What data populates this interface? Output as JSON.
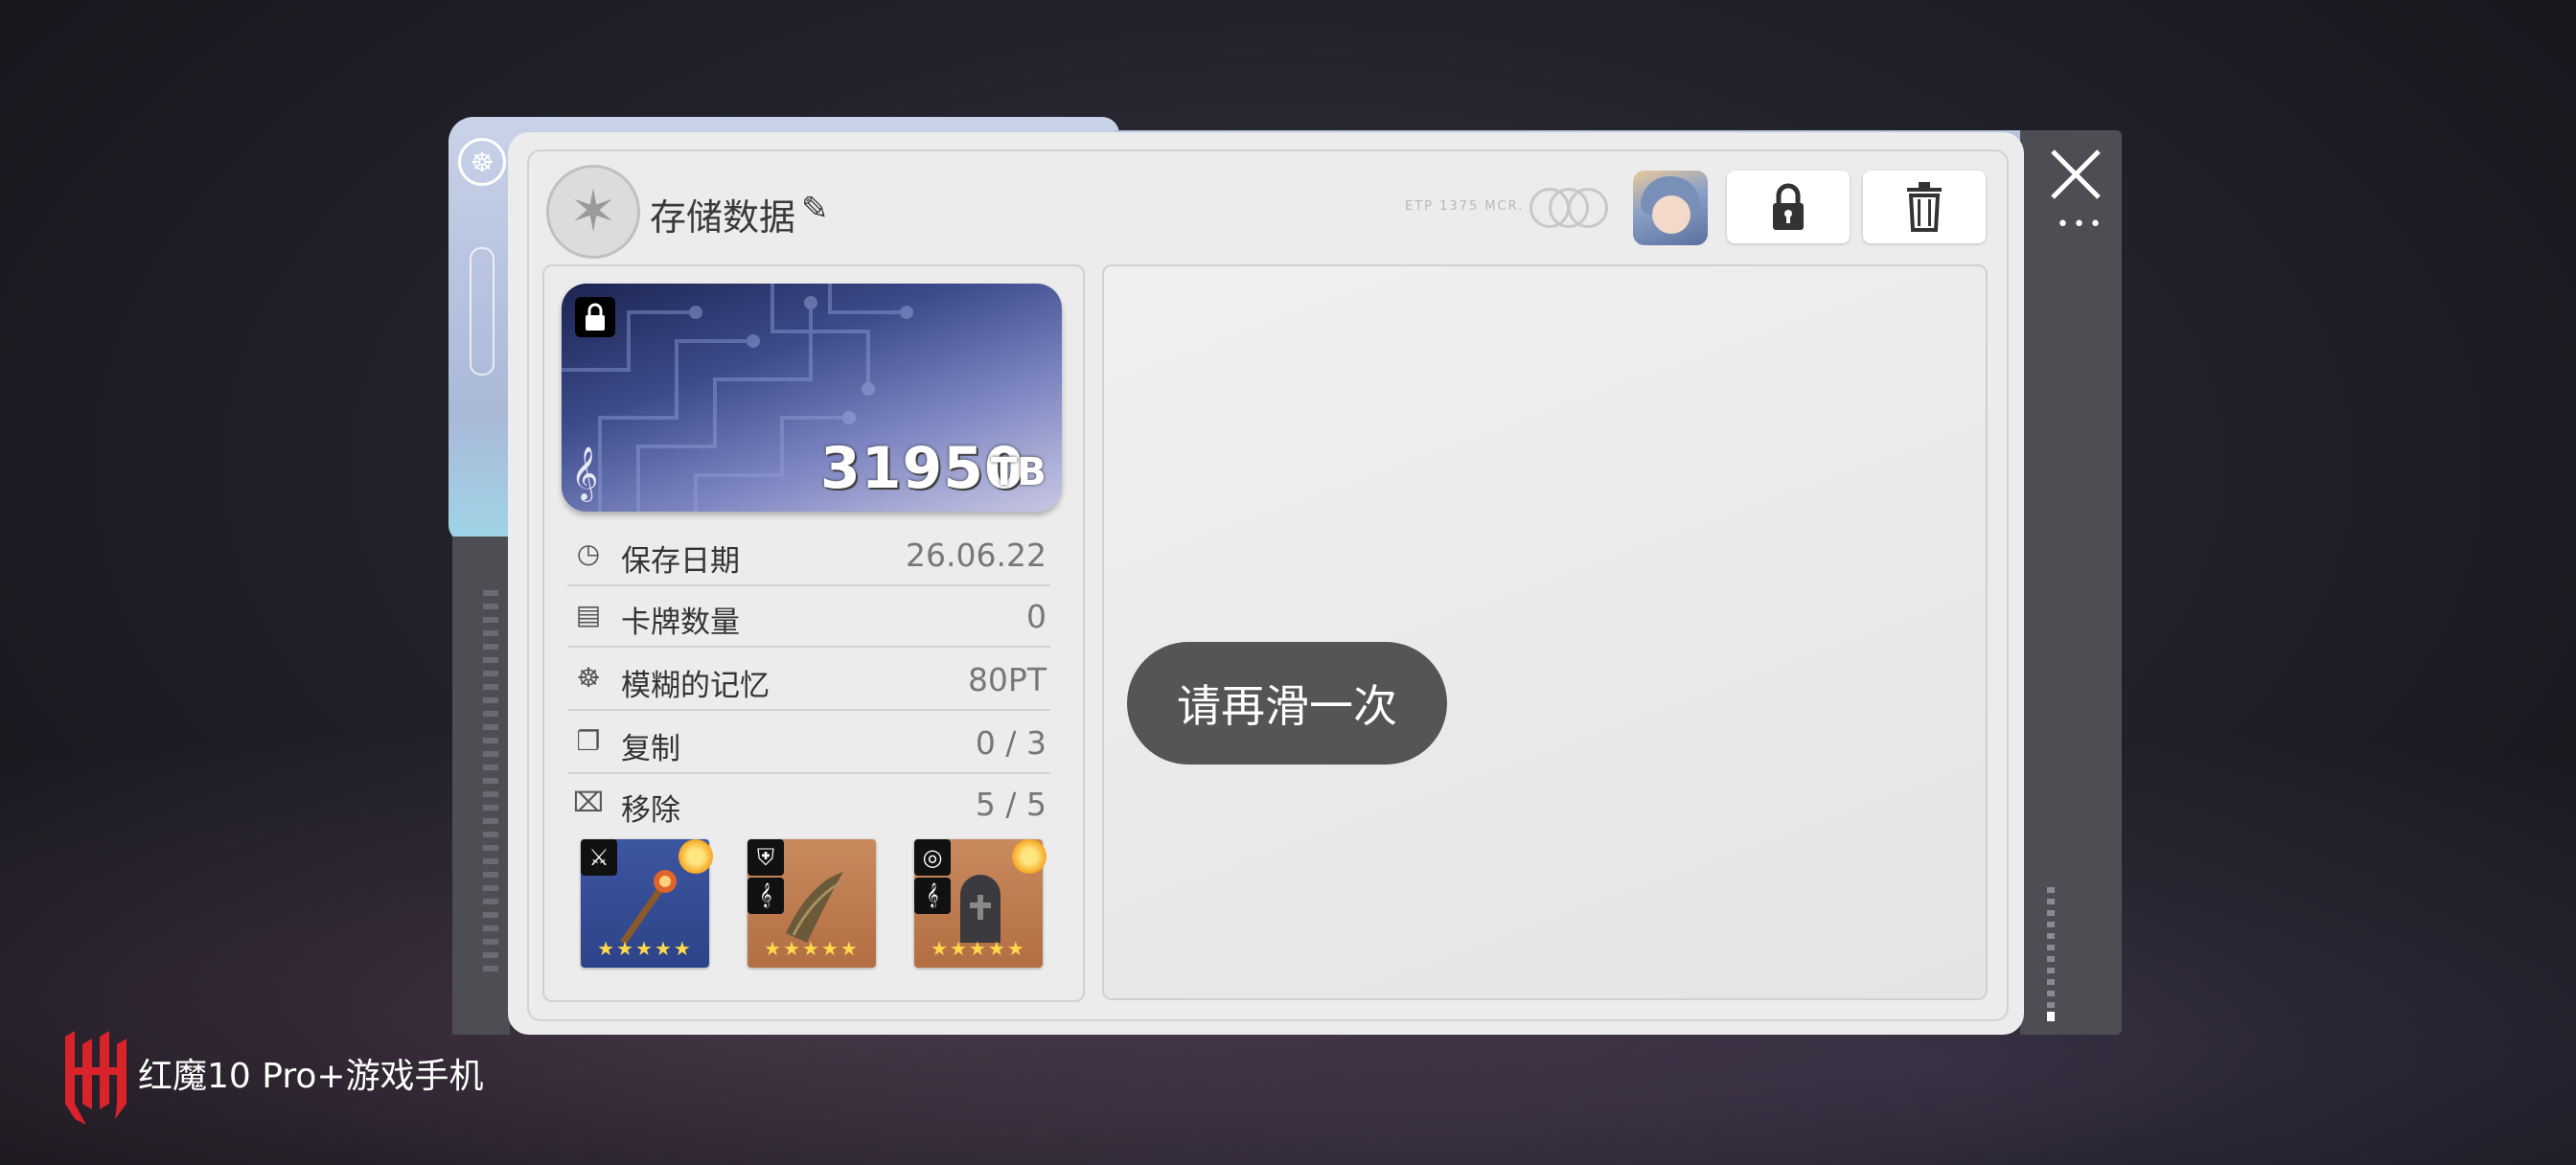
{
  "header": {
    "title": "存储数据",
    "tiny_text": "ETP 1375 MCR."
  },
  "card": {
    "value": "31950",
    "unit": "TB"
  },
  "stats": [
    {
      "icon": "clock-icon",
      "label": "保存日期",
      "value": "26.06.22"
    },
    {
      "icon": "card-icon",
      "label": "卡牌数量",
      "value": "0"
    },
    {
      "icon": "brain-icon",
      "label": "模糊的记忆",
      "value": "80PT"
    },
    {
      "icon": "copy-icon",
      "label": "复制",
      "value": "0 / 3"
    },
    {
      "icon": "remove-icon",
      "label": "移除",
      "value": "5 / 5"
    }
  ],
  "items": [
    {
      "name": "scepter",
      "stars": "★★★★★",
      "stars_count": 5,
      "color": "#3c56a0"
    },
    {
      "name": "wings",
      "stars": "★★★★★",
      "stars_count": 5,
      "color": "#c98a5e"
    },
    {
      "name": "tombstone",
      "stars": "★★★★★",
      "stars_count": 5,
      "color": "#c98a5e"
    }
  ],
  "toast": "请再滑一次",
  "watermark": "红魔10 Pro+游戏手机",
  "colors": {
    "panel": "#ececec",
    "toast_bg": "#555555",
    "accent_red": "#d8232a"
  }
}
